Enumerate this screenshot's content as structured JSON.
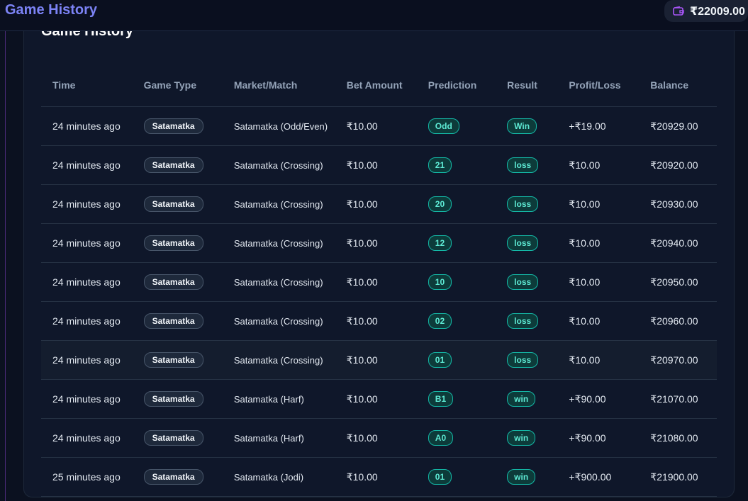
{
  "header": {
    "app_title": "Game History",
    "wallet_amount": "₹22009.00"
  },
  "card": {
    "title": "Game History"
  },
  "table": {
    "columns": [
      "Time",
      "Game Type",
      "Market/Match",
      "Bet Amount",
      "Prediction",
      "Result",
      "Profit/Loss",
      "Balance"
    ],
    "rows": [
      {
        "time": "24 minutes ago",
        "game_type": "Satamatka",
        "market": "Satamatka (Odd/Even)",
        "bet": "₹10.00",
        "prediction": "Odd",
        "result": "Win",
        "pl": "+₹19.00",
        "pl_type": "pos",
        "balance": "₹20929.00"
      },
      {
        "time": "24 minutes ago",
        "game_type": "Satamatka",
        "market": "Satamatka (Crossing)",
        "bet": "₹10.00",
        "prediction": "21",
        "result": "loss",
        "pl": "₹10.00",
        "pl_type": "neg",
        "balance": "₹20920.00"
      },
      {
        "time": "24 minutes ago",
        "game_type": "Satamatka",
        "market": "Satamatka (Crossing)",
        "bet": "₹10.00",
        "prediction": "20",
        "result": "loss",
        "pl": "₹10.00",
        "pl_type": "neg",
        "balance": "₹20930.00"
      },
      {
        "time": "24 minutes ago",
        "game_type": "Satamatka",
        "market": "Satamatka (Crossing)",
        "bet": "₹10.00",
        "prediction": "12",
        "result": "loss",
        "pl": "₹10.00",
        "pl_type": "neg",
        "balance": "₹20940.00"
      },
      {
        "time": "24 minutes ago",
        "game_type": "Satamatka",
        "market": "Satamatka (Crossing)",
        "bet": "₹10.00",
        "prediction": "10",
        "result": "loss",
        "pl": "₹10.00",
        "pl_type": "neg",
        "balance": "₹20950.00"
      },
      {
        "time": "24 minutes ago",
        "game_type": "Satamatka",
        "market": "Satamatka (Crossing)",
        "bet": "₹10.00",
        "prediction": "02",
        "result": "loss",
        "pl": "₹10.00",
        "pl_type": "neg",
        "balance": "₹20960.00"
      },
      {
        "time": "24 minutes ago",
        "game_type": "Satamatka",
        "market": "Satamatka (Crossing)",
        "bet": "₹10.00",
        "prediction": "01",
        "result": "loss",
        "pl": "₹10.00",
        "pl_type": "neg",
        "balance": "₹20970.00",
        "highlighted": true
      },
      {
        "time": "24 minutes ago",
        "game_type": "Satamatka",
        "market": "Satamatka (Harf)",
        "bet": "₹10.00",
        "prediction": "B1",
        "result": "win",
        "pl": "+₹90.00",
        "pl_type": "pos",
        "balance": "₹21070.00"
      },
      {
        "time": "24 minutes ago",
        "game_type": "Satamatka",
        "market": "Satamatka (Harf)",
        "bet": "₹10.00",
        "prediction": "A0",
        "result": "win",
        "pl": "+₹90.00",
        "pl_type": "pos",
        "balance": "₹21080.00"
      },
      {
        "time": "25 minutes ago",
        "game_type": "Satamatka",
        "market": "Satamatka (Jodi)",
        "bet": "₹10.00",
        "prediction": "01",
        "result": "win",
        "pl": "+₹900.00",
        "pl_type": "pos",
        "balance": "₹21900.00"
      }
    ]
  },
  "icons": {
    "wallet": "wallet-icon"
  },
  "colors": {
    "accent": "#7c83f5",
    "wallet_icon": "#a855f7",
    "positive": "#5eead4",
    "negative": "#f87171",
    "balance": "#4ade80"
  }
}
